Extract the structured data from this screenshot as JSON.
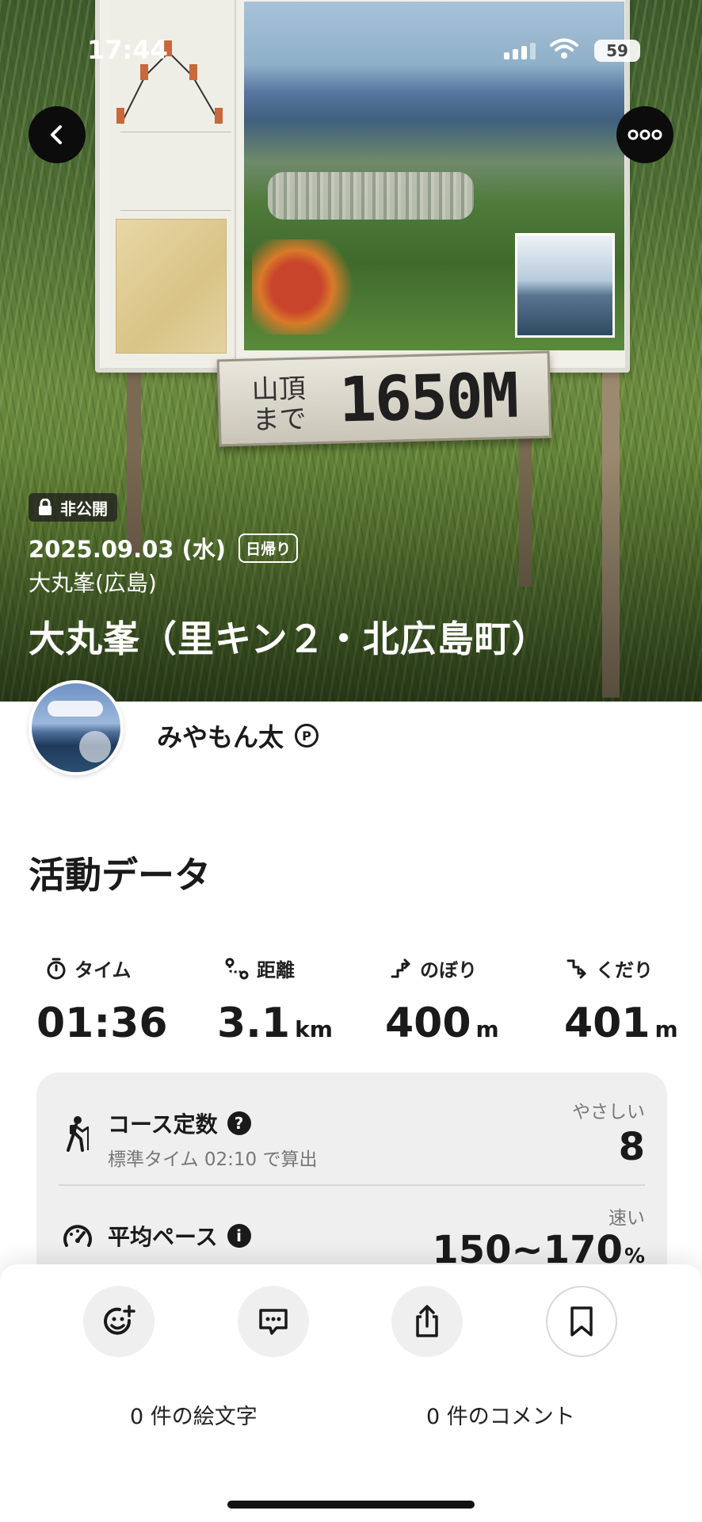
{
  "status_bar": {
    "time": "17:44",
    "battery": "59"
  },
  "hero": {
    "sign_text": "1650M",
    "sign_small_text": "山頂まで",
    "private_label": "非公開",
    "date": "2025.09.03 (水)",
    "trip_type": "日帰り",
    "mountain": "大丸峯(広島)",
    "title": "大丸峯（里キン２・北広島町）"
  },
  "user": {
    "name": "みやもん太",
    "premium_badge": "P"
  },
  "activity": {
    "section_title": "活動データ",
    "stats": [
      {
        "label": "タイム",
        "value": "01:36",
        "unit": "",
        "icon": "stopwatch-icon"
      },
      {
        "label": "距離",
        "value": "3.1",
        "unit": "km",
        "icon": "route-icon"
      },
      {
        "label": "のぼり",
        "value": "400",
        "unit": "m",
        "icon": "ascent-icon"
      },
      {
        "label": "くだり",
        "value": "401",
        "unit": "m",
        "icon": "descent-icon"
      }
    ],
    "course_constant": {
      "label": "コース定数",
      "sub": "標準タイム 02:10 で算出",
      "grade": "やさしい",
      "value": "8"
    },
    "average_pace": {
      "label": "平均ペース",
      "grade": "速い",
      "value": "150~170",
      "unit": "%"
    }
  },
  "bottom_bar": {
    "emoji_count": "0 件の絵文字",
    "comment_count": "0 件のコメント",
    "buttons": [
      "emoji-add-icon",
      "comment-icon",
      "share-icon",
      "bookmark-icon"
    ]
  }
}
